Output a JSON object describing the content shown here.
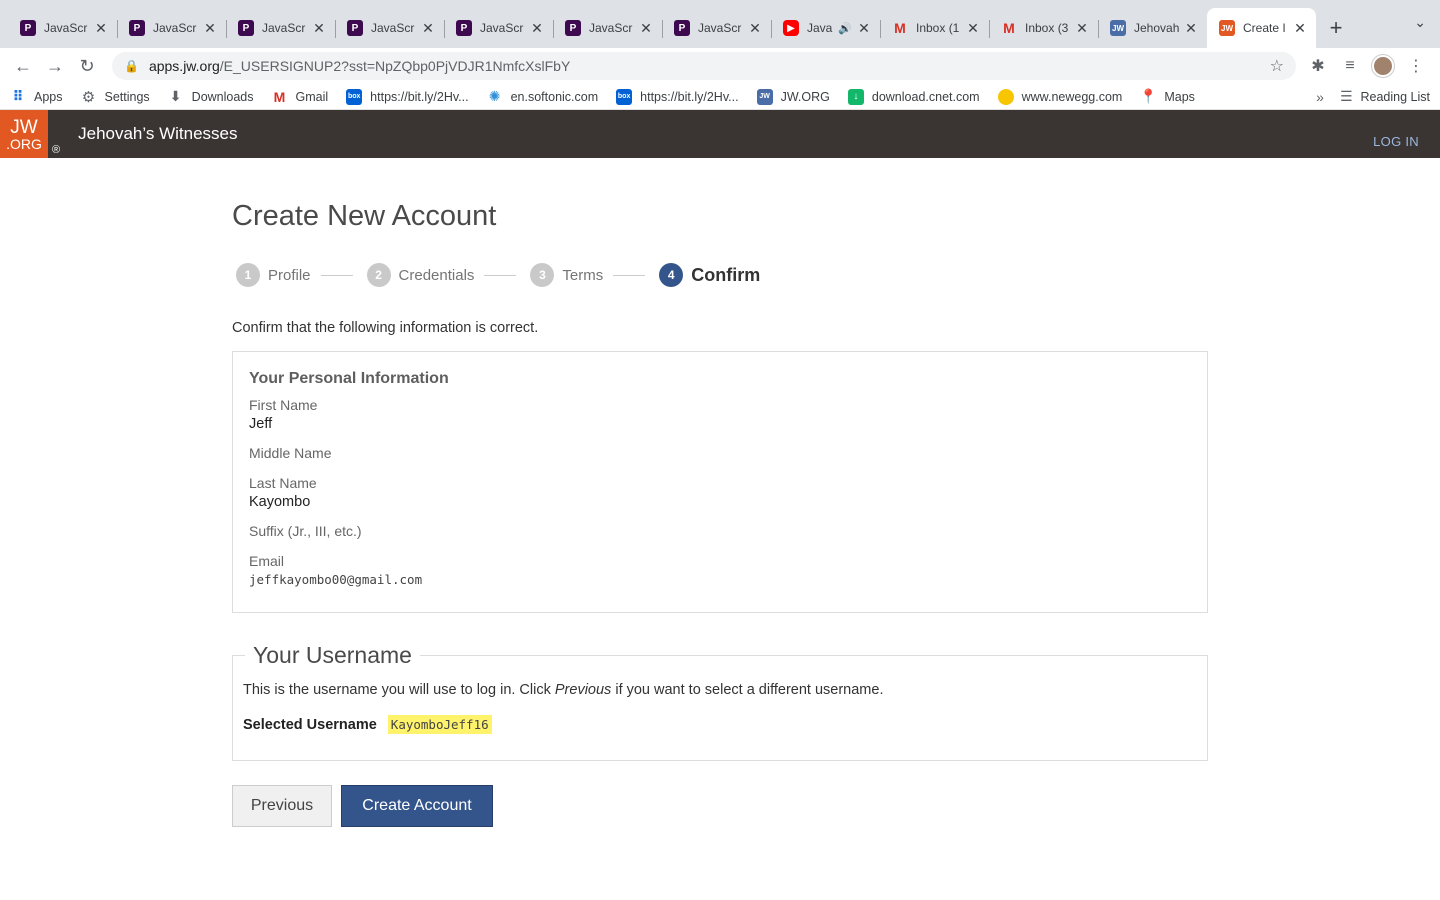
{
  "browser": {
    "tabs": [
      {
        "title": "JavaScr",
        "favicon": "p-icon"
      },
      {
        "title": "JavaScr",
        "favicon": "p-icon"
      },
      {
        "title": "JavaScr",
        "favicon": "p-icon"
      },
      {
        "title": "JavaScr",
        "favicon": "p-icon"
      },
      {
        "title": "JavaScr",
        "favicon": "p-icon"
      },
      {
        "title": "JavaScr",
        "favicon": "p-icon"
      },
      {
        "title": "JavaScr",
        "favicon": "p-icon"
      },
      {
        "title": "Java",
        "favicon": "youtube-icon"
      },
      {
        "title": "Inbox (1",
        "favicon": "gmail-icon"
      },
      {
        "title": "Inbox (3",
        "favicon": "gmail-icon"
      },
      {
        "title": "Jehovah",
        "favicon": "jw-icon"
      },
      {
        "title": "Create I",
        "favicon": "jw-orange-icon",
        "active": true
      }
    ],
    "url_host": "apps.jw.org",
    "url_path": "/E_USERSIGNUP2?sst=NpZQbp0PjVDJR1NmfcXslFbY",
    "bookmarks": [
      {
        "label": "Apps"
      },
      {
        "label": "Settings"
      },
      {
        "label": "Downloads"
      },
      {
        "label": "Gmail"
      },
      {
        "label": "https://bit.ly/2Hv..."
      },
      {
        "label": "en.softonic.com"
      },
      {
        "label": "https://bit.ly/2Hv..."
      },
      {
        "label": "JW.ORG"
      },
      {
        "label": "download.cnet.com"
      },
      {
        "label": "www.newegg.com"
      },
      {
        "label": "Maps"
      }
    ],
    "reading_list": "Reading List"
  },
  "site": {
    "logo_line1": "JW",
    "logo_line2": ".ORG",
    "registered": "®",
    "name": "Jehovah’s Witnesses",
    "login": "LOG IN"
  },
  "page": {
    "title": "Create New Account",
    "steps": [
      {
        "num": "1",
        "label": "Profile"
      },
      {
        "num": "2",
        "label": "Credentials"
      },
      {
        "num": "3",
        "label": "Terms"
      },
      {
        "num": "4",
        "label": "Confirm",
        "active": true
      }
    ],
    "intro": "Confirm that the following information is correct.",
    "personal": {
      "heading": "Your Personal Information",
      "first_name_label": "First Name",
      "first_name": "Jeff",
      "middle_name_label": "Middle Name",
      "middle_name": "",
      "last_name_label": "Last Name",
      "last_name": "Kayombo",
      "suffix_label": "Suffix (Jr., III, etc.)",
      "suffix": "",
      "email_label": "Email",
      "email": "jeffkayombo00@gmail.com"
    },
    "username": {
      "legend": "Your Username",
      "text_before": "This is the username you will use to log in. Click ",
      "text_em": "Previous",
      "text_after": " if you want to select a different username.",
      "selected_label": "Selected Username",
      "selected_value": "KayomboJeff16"
    },
    "buttons": {
      "previous": "Previous",
      "create": "Create Account"
    }
  }
}
